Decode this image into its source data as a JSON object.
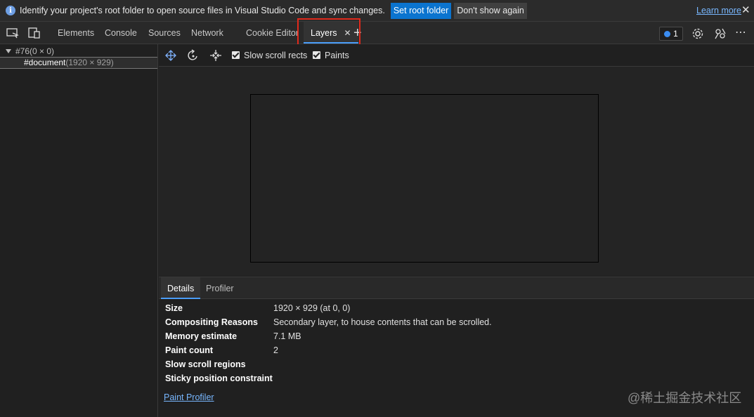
{
  "infobar": {
    "message": "Identify your project's root folder to open source files in Visual Studio Code and sync changes.",
    "set_root_label": "Set root folder",
    "dont_show_label": "Don't show again",
    "learn_more_label": "Learn more",
    "close_glyph": "✕",
    "info_glyph": "i"
  },
  "tabs": {
    "items": [
      {
        "label": "Elements"
      },
      {
        "label": "Console"
      },
      {
        "label": "Sources"
      },
      {
        "label": "Network"
      },
      {
        "label": "Cookie Editor"
      },
      {
        "label": "Layers"
      }
    ],
    "active_close_glyph": "✕",
    "add_glyph": "+",
    "issues_count": "1",
    "more_glyph": "⋯"
  },
  "layer_tree": {
    "root": {
      "name": "#76",
      "size": "(0 × 0)"
    },
    "child": {
      "name": "#document",
      "size": "(1920 × 929)"
    }
  },
  "toolbar": {
    "slow_scroll_label": "Slow scroll rects",
    "paints_label": "Paints",
    "slow_scroll_checked": true,
    "paints_checked": true
  },
  "bottom_tabs": {
    "details_label": "Details",
    "profiler_label": "Profiler"
  },
  "details": {
    "rows": [
      {
        "key": "Size",
        "value": "1920 × 929 (at 0, 0)"
      },
      {
        "key": "Compositing Reasons",
        "value": "Secondary layer, to house contents that can be scrolled."
      },
      {
        "key": "Memory estimate",
        "value": "7.1 MB"
      },
      {
        "key": "Paint count",
        "value": "2"
      },
      {
        "key": "Slow scroll regions",
        "value": ""
      },
      {
        "key": "Sticky position constraint",
        "value": ""
      }
    ],
    "paint_profiler_label": "Paint Profiler"
  },
  "watermark": "@稀土掘金技术社区",
  "colors": {
    "accent": "#4a9df8",
    "primary_button": "#0b74cf",
    "link": "#78b7ff",
    "highlight_box": "#e0291b"
  }
}
